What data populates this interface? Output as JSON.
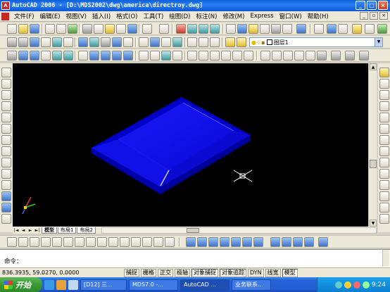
{
  "window": {
    "title": "AutoCAD 2006 - [D:\\MDS2002\\dwg\\america\\directroy.dwg]",
    "app_icon": "A",
    "minimize": "_",
    "maximize": "□",
    "close": "×"
  },
  "menu": {
    "items": [
      "文件(F)",
      "编辑(E)",
      "视图(V)",
      "插入(I)",
      "格式(O)",
      "工具(T)",
      "绘图(D)",
      "标注(N)",
      "修改(M)",
      "Express",
      "窗口(W)",
      "帮助(H)"
    ],
    "doc_min": "_",
    "doc_max": "▫",
    "doc_close": "×"
  },
  "toolbar": {
    "layer_name": "图层1",
    "combo_arrow": "▼"
  },
  "tabs": {
    "nav": [
      "|◄",
      "◄",
      "►",
      "►|"
    ],
    "items": [
      "模型",
      "布局1",
      "布局2"
    ]
  },
  "command": {
    "prompt": "命令："
  },
  "status": {
    "coords": "836.3935, 59.0270, 0.0000",
    "buttons": [
      "捕捉",
      "栅格",
      "正交",
      "极轴",
      "对象捕捉",
      "对象追踪",
      "DYN",
      "线宽",
      "模型"
    ],
    "active": [
      "对象捕捉",
      "对象追踪",
      "模型"
    ]
  },
  "taskbar": {
    "start": "开始",
    "tasks": [
      "[D12] 三...",
      "MDS7.0 -...",
      "AutoCAD ...",
      "业务联系..."
    ],
    "clock": "9:24"
  },
  "viewport": {
    "background": "#000000",
    "model_color": "#0a0af0",
    "crosshair_color": "#ffffff"
  }
}
